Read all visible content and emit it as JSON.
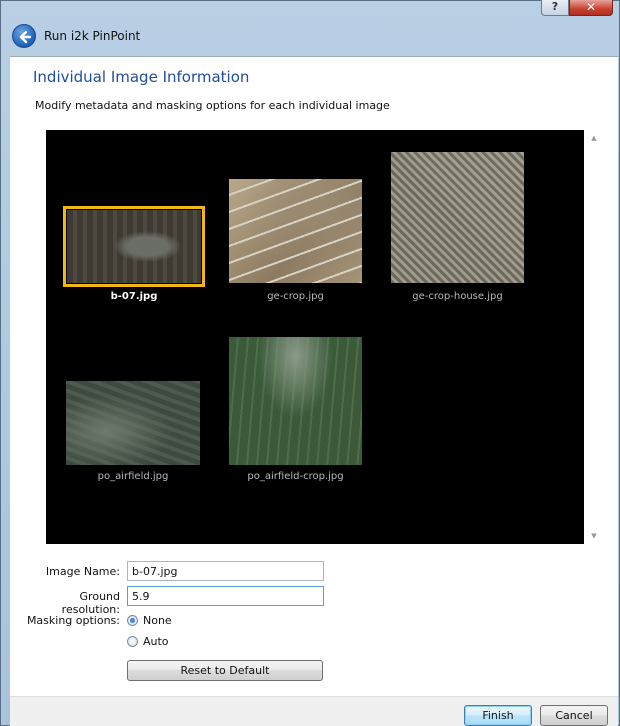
{
  "window": {
    "title": "Run i2k PinPoint",
    "help_glyph": "?",
    "close_glyph": "✕"
  },
  "page": {
    "heading": "Individual Image Information",
    "subtitle": "Modify metadata and masking options for each individual image"
  },
  "gallery": {
    "images": [
      {
        "name": "b-07.jpg",
        "selected": true
      },
      {
        "name": "ge-crop.jpg",
        "selected": false
      },
      {
        "name": "ge-crop-house.jpg",
        "selected": false
      },
      {
        "name": "po_airfield.jpg",
        "selected": false
      },
      {
        "name": "po_airfield-crop.jpg",
        "selected": false
      }
    ],
    "scroll_up_glyph": "▲",
    "scroll_down_glyph": "▼"
  },
  "form": {
    "image_name_label": "Image Name:",
    "image_name_value": "b-07.jpg",
    "ground_resolution_label": "Ground resolution:",
    "ground_resolution_value": "5.9",
    "masking_label": "Masking options:",
    "masking_options": [
      {
        "label": "None",
        "checked": true
      },
      {
        "label": "Auto",
        "checked": false
      }
    ],
    "reset_button": "Reset to Default"
  },
  "footer": {
    "finish_button": "Finish",
    "cancel_button": "Cancel"
  },
  "colors": {
    "heading": "#1f4e9c",
    "selection": "#f1b813",
    "gallery_bg": "#000000"
  }
}
